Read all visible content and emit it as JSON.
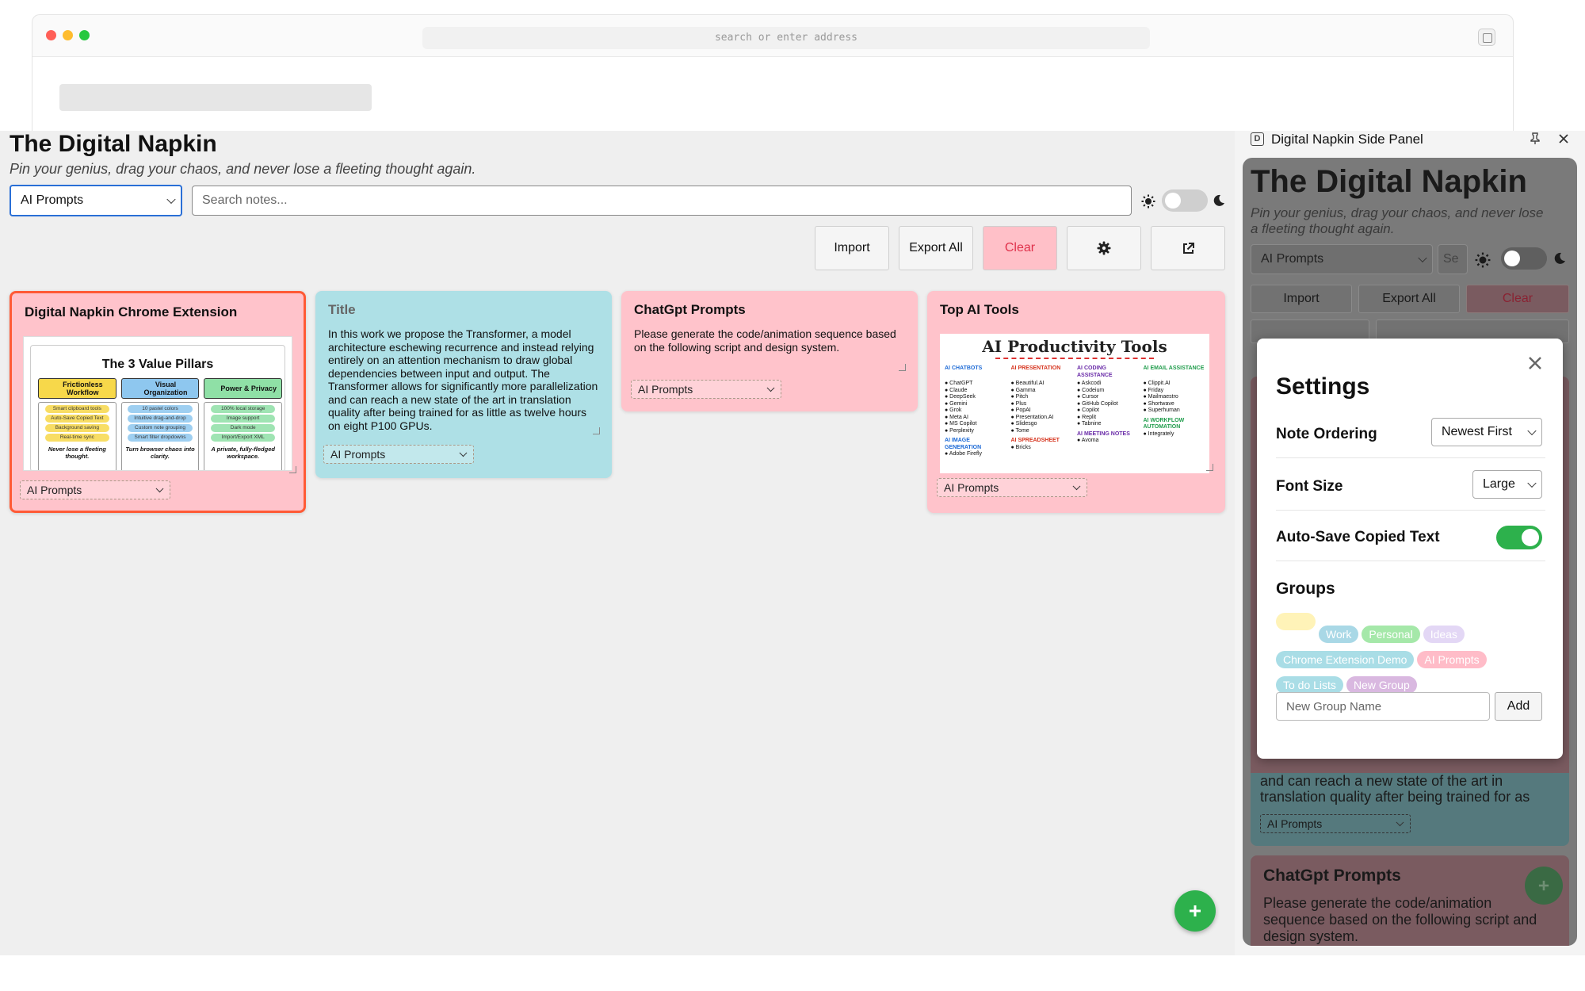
{
  "browser": {
    "address_placeholder": "search or enter address"
  },
  "app": {
    "title": "The Digital Napkin",
    "subtitle": "Pin your genius, drag your chaos, and never lose a fleeting thought again.",
    "group_select": "AI Prompts",
    "search_placeholder": "Search notes...",
    "buttons": {
      "import": "Import",
      "export": "Export All",
      "clear": "Clear"
    },
    "colors": {
      "accent_orange": "#ff5a36",
      "clear_bg": "#ffc0c8",
      "add_fab": "#2db14c"
    }
  },
  "notes": [
    {
      "title": "Digital Napkin Chrome Extension",
      "group": "AI Prompts",
      "color": "#ffc3cb",
      "image": {
        "heading": "The 3 Value Pillars",
        "pillars": [
          {
            "name": "Frictionless Workflow",
            "color": "#f7d84a",
            "items": [
              "Smart clipboard tools",
              "Auto-Save Copied Text",
              "Background saving",
              "Real-time sync"
            ],
            "footer": "Never lose a fleeting thought."
          },
          {
            "name": "Visual Organization",
            "color": "#8ec7ef",
            "items": [
              "10 pastel colors",
              "Intuitive drag-and-drop",
              "Custom note grouping",
              "Smart filter dropdowns"
            ],
            "footer": "Turn browser chaos into clarity."
          },
          {
            "name": "Power & Privacy",
            "color": "#8fe0a6",
            "items": [
              "100% local storage",
              "Image support",
              "Dark mode",
              "Import/Export XML"
            ],
            "footer": "A private, fully-fledged workspace."
          }
        ]
      }
    },
    {
      "title": "Title",
      "group": "AI Prompts",
      "color": "#aee0e6",
      "body": "In this work we propose the Transformer, a model architecture eschewing recurrence and instead relying entirely on an attention mechanism to draw global dependencies between input and output. The Transformer allows for significantly more parallelization and can reach a new state of the art in translation quality after being trained for as little as twelve hours on eight P100 GPUs."
    },
    {
      "title": "ChatGpt Prompts",
      "group": "AI Prompts",
      "color": "#ffc3cb",
      "body": "Please generate the code/animation sequence based on the following script and design system."
    },
    {
      "title": "Top AI Tools",
      "group": "AI Prompts",
      "color": "#ffc3cb",
      "image": {
        "heading": "AI Productivity Tools",
        "columns": [
          {
            "name": "AI CHATBOTS",
            "items": [
              "ChatGPT",
              "Claude",
              "DeepSeek",
              "Gemini",
              "Grok",
              "Meta AI",
              "MS Copilot",
              "Perplexity"
            ]
          },
          {
            "name": "AI PRESENTATION",
            "items": [
              "Beautiful.AI",
              "Gamma",
              "Pitch",
              "Plus",
              "PopAI",
              "Presentation.AI",
              "Slidesgo",
              "Tome"
            ]
          },
          {
            "name": "AI CODING ASSISTANCE",
            "items": [
              "Askcodi",
              "Codeium",
              "Cursor",
              "GitHub Copilot",
              "Copilot",
              "Replit",
              "Tabnine"
            ]
          },
          {
            "name": "AI EMAIL ASSISTANCE",
            "items": [
              "Clippit.AI",
              "Friday",
              "Mailmaestro",
              "Shortwave",
              "Superhuman"
            ]
          }
        ],
        "second_row": [
          "AI IMAGE GENERATION",
          "AI SPREADSHEET",
          "AI MEETING NOTES",
          "AI WORKFLOW AUTOMATION"
        ],
        "second_row_items": [
          "Adobe Firefly",
          "Bricks",
          "Avoma",
          "Integrately"
        ]
      }
    }
  ],
  "side_panel": {
    "header": "Digital Napkin Side Panel",
    "title": "The Digital Napkin",
    "subtitle": "Pin your genius, drag your chaos, and never lose a fleeting thought again.",
    "group_select": "AI Prompts",
    "search_placeholder": "Se",
    "buttons": {
      "import": "Import",
      "export": "Export All",
      "clear": "Clear"
    },
    "bg_text": "and can reach a new state of the art in translation quality after being trained for as",
    "bg_group": "AI Prompts",
    "bg_card_title": "ChatGpt Prompts",
    "bg_card_body": "Please generate the code/animation sequence based on the following script and design system."
  },
  "settings": {
    "title": "Settings",
    "note_ordering_label": "Note Ordering",
    "note_ordering_value": "Newest First",
    "font_size_label": "Font Size",
    "font_size_value": "Large",
    "autosave_label": "Auto-Save Copied Text",
    "autosave_on": true,
    "groups_label": "Groups",
    "groups": [
      {
        "name": "",
        "color": "#fff3b8"
      },
      {
        "name": "Work",
        "color": "#a9d8e6"
      },
      {
        "name": "Personal",
        "color": "#a5e8a9"
      },
      {
        "name": "Ideas",
        "color": "#e3d7f5"
      },
      {
        "name": "Chrome Extension Demo",
        "color": "#a9dde6"
      },
      {
        "name": "AI Prompts",
        "color": "#ffbcc8"
      },
      {
        "name": "To do Lists",
        "color": "#a9dde6"
      },
      {
        "name": "New Group",
        "color": "#d9b8e0"
      }
    ],
    "new_group_placeholder": "New Group Name",
    "add_label": "Add"
  }
}
